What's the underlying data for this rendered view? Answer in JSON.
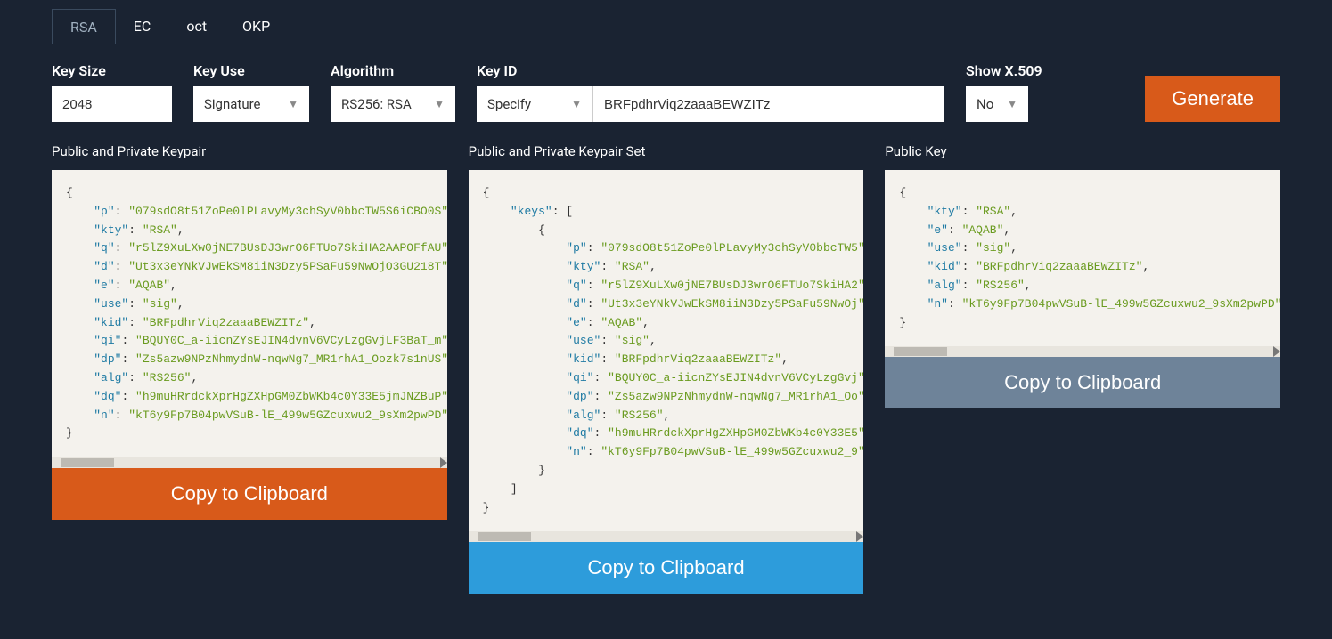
{
  "tabs": [
    "RSA",
    "EC",
    "oct",
    "OKP"
  ],
  "active_tab": "RSA",
  "controls": {
    "key_size": {
      "label": "Key Size",
      "value": "2048"
    },
    "key_use": {
      "label": "Key Use",
      "value": "Signature"
    },
    "algorithm": {
      "label": "Algorithm",
      "value": "RS256: RSA"
    },
    "key_id": {
      "label": "Key ID",
      "select": "Specify",
      "value": "BRFpdhrViq2zaaaBEWZITz"
    },
    "show_x509": {
      "label": "Show X.509",
      "value": "No"
    },
    "generate": "Generate"
  },
  "panels": {
    "keypair": {
      "title": "Public and Private Keypair",
      "copy": "Copy to Clipboard",
      "json": {
        "p": "079sdO8t51ZoPe0lPLavyMy3chSyV0bbcTW5S6iCBO0S",
        "kty": "RSA",
        "q": "r5lZ9XuLXw0jNE7BUsDJ3wrO6FTUo7SkiHA2AAPOFfAU",
        "d": "Ut3x3eYNkVJwEkSM8iiN3Dzy5PSaFu59NwOjO3GU218T",
        "e": "AQAB",
        "use": "sig",
        "kid": "BRFpdhrViq2zaaaBEWZITz",
        "qi": "BQUY0C_a-iicnZYsEJIN4dvnV6VCyLzgGvjLF3BaT_m",
        "dp": "Zs5azw9NPzNhmydnW-nqwNg7_MR1rhA1_Oozk7s1nUS",
        "alg": "RS256",
        "dq": "h9muHRrdckXprHgZXHpGM0ZbWKb4c0Y33E5jmJNZBuP",
        "n": "kT6y9Fp7B04pwVSuB-lE_499w5GZcuxwu2_9sXm2pwPD"
      }
    },
    "keypair_set": {
      "title": "Public and Private Keypair Set",
      "copy": "Copy to Clipboard",
      "json": {
        "keys": [
          {
            "p": "079sdO8t51ZoPe0lPLavyMy3chSyV0bbcTW5",
            "kty": "RSA",
            "q": "r5lZ9XuLXw0jNE7BUsDJ3wrO6FTUo7SkiHA2",
            "d": "Ut3x3eYNkVJwEkSM8iiN3Dzy5PSaFu59NwOj",
            "e": "AQAB",
            "use": "sig",
            "kid": "BRFpdhrViq2zaaaBEWZITz",
            "qi": "BQUY0C_a-iicnZYsEJIN4dvnV6VCyLzgGvj",
            "dp": "Zs5azw9NPzNhmydnW-nqwNg7_MR1rhA1_Oo",
            "alg": "RS256",
            "dq": "h9muHRrdckXprHgZXHpGM0ZbWKb4c0Y33E5",
            "n": "kT6y9Fp7B04pwVSuB-lE_499w5GZcuxwu2_9"
          }
        ]
      }
    },
    "public_key": {
      "title": "Public Key",
      "copy": "Copy to Clipboard",
      "json": {
        "kty": "RSA",
        "e": "AQAB",
        "use": "sig",
        "kid": "BRFpdhrViq2zaaaBEWZITz",
        "alg": "RS256",
        "n": "kT6y9Fp7B04pwVSuB-lE_499w5GZcuxwu2_9sXm2pwPD"
      }
    }
  }
}
